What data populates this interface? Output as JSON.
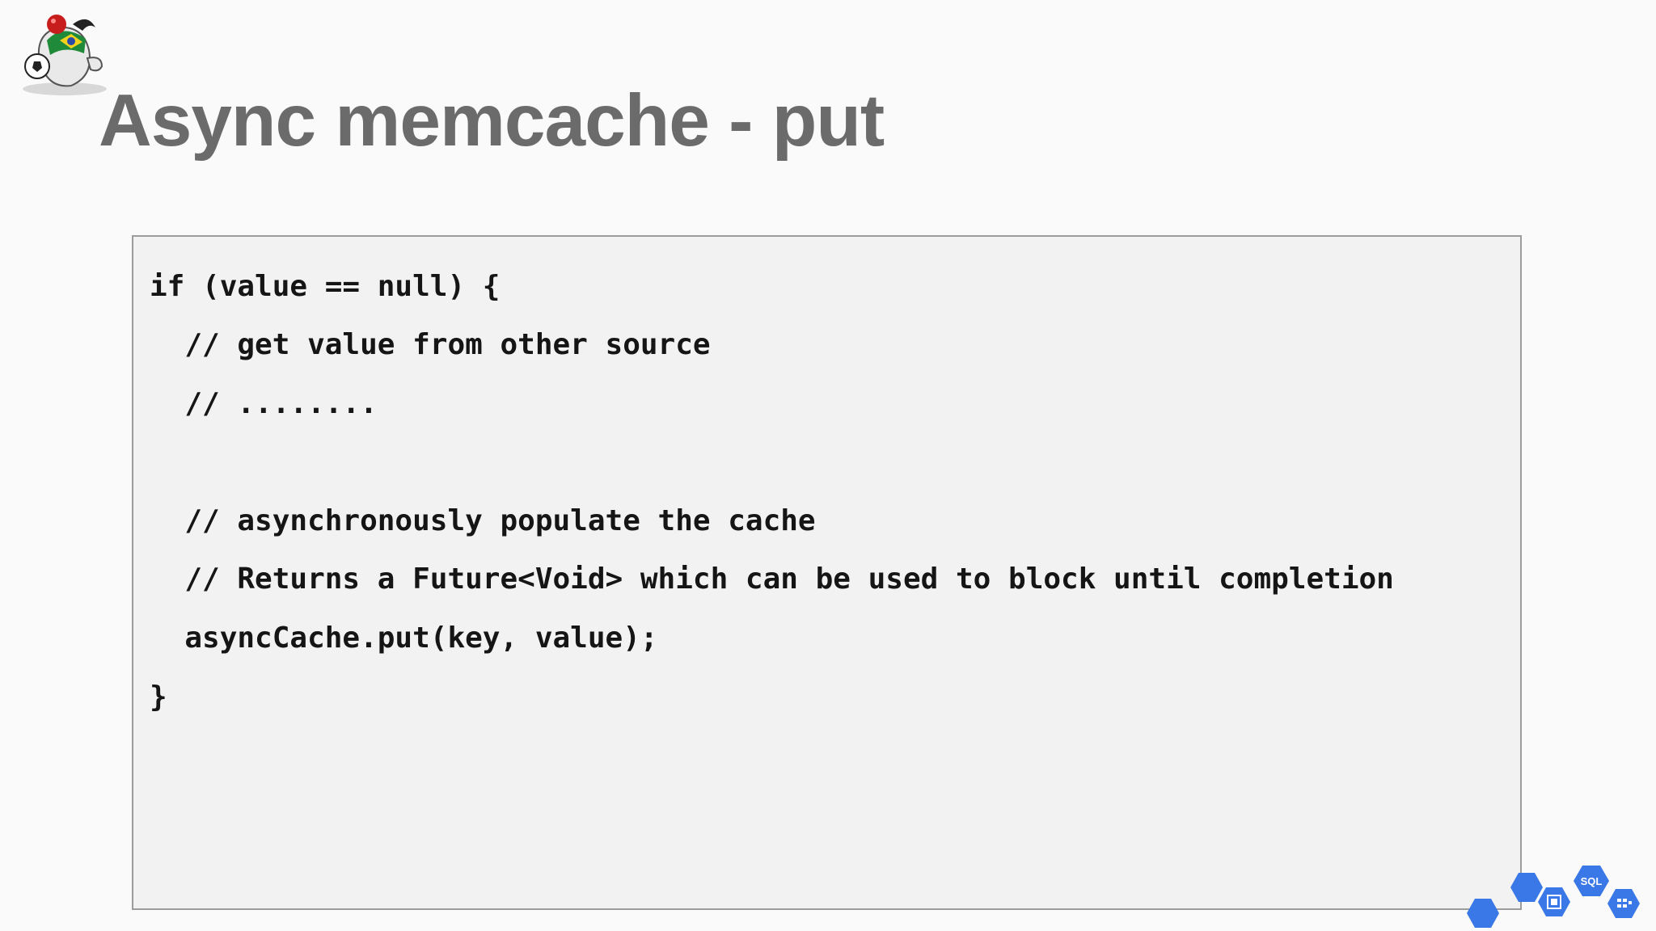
{
  "slide": {
    "title": "Async memcache - put",
    "mascot_icon": "duke-soccer-mascot-icon",
    "code_lines": [
      "if (value == null) {",
      "  // get value from other source",
      "  // ........",
      "",
      "  // asynchronously populate the cache",
      "  // Returns a Future<Void> which can be used to block until completion",
      "  asyncCache.put(key, value);",
      "}"
    ],
    "badge": {
      "icon": "cloud-services-hexagon-icons",
      "sql_label": "SQL",
      "color": "#3b78e7"
    }
  }
}
